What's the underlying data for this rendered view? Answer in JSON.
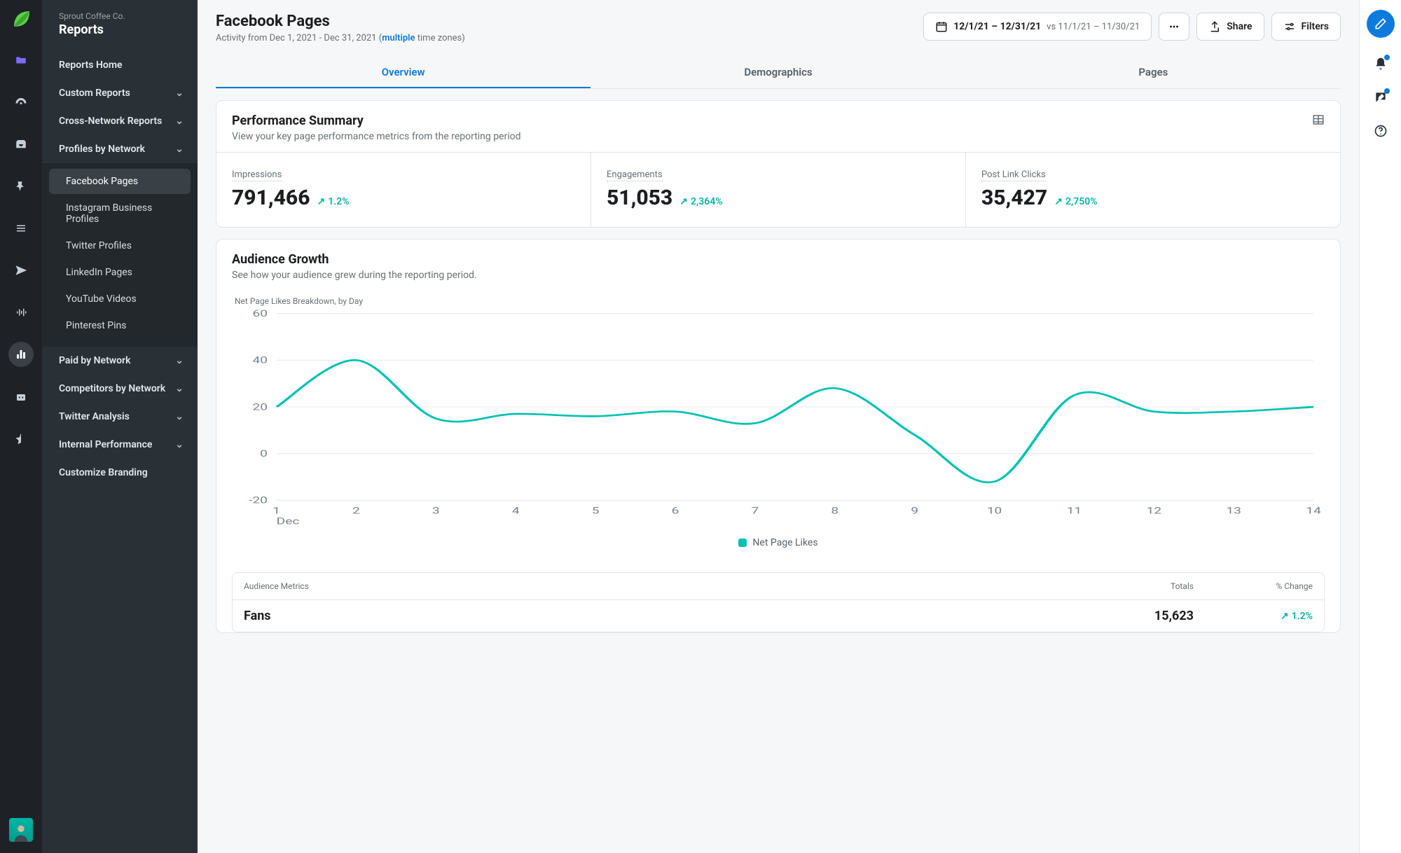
{
  "org": {
    "name": "Sprout Coffee Co.",
    "section": "Reports"
  },
  "sidebar": {
    "home": "Reports Home",
    "custom": "Custom Reports",
    "cross": "Cross-Network Reports",
    "profiles": "Profiles by Network",
    "sub": {
      "facebook": "Facebook Pages",
      "instagram": "Instagram Business Profiles",
      "twitter": "Twitter Profiles",
      "linkedin": "LinkedIn Pages",
      "youtube": "YouTube Videos",
      "pinterest": "Pinterest Pins"
    },
    "paid": "Paid by Network",
    "competitors": "Competitors by Network",
    "twitter_analysis": "Twitter Analysis",
    "internal": "Internal Performance",
    "branding": "Customize Branding"
  },
  "header": {
    "title": "Facebook Pages",
    "activity_prefix": "Activity from Dec 1, 2021 - Dec 31, 2021 (",
    "multiple": "multiple",
    "activity_suffix": " time zones)",
    "date_main": "12/1/21 – 12/31/21",
    "date_vs": " vs 11/1/21 – 11/30/21",
    "share": "Share",
    "filters": "Filters"
  },
  "tabs": {
    "overview": "Overview",
    "demographics": "Demographics",
    "pages": "Pages"
  },
  "perf": {
    "title": "Performance Summary",
    "sub": "View your key page performance metrics from the reporting period",
    "metrics": {
      "impressions": {
        "label": "Impressions",
        "value": "791,466",
        "delta": "1.2%"
      },
      "engagements": {
        "label": "Engagements",
        "value": "51,053",
        "delta": "2,364%"
      },
      "clicks": {
        "label": "Post Link Clicks",
        "value": "35,427",
        "delta": "2,750%"
      }
    }
  },
  "growth": {
    "title": "Audience Growth",
    "sub": "See how your audience grew during the reporting period.",
    "chart_caption": "Net Page Likes Breakdown, by Day",
    "legend": "Net Page Likes",
    "x_month": "Dec",
    "table": {
      "h1": "Audience Metrics",
      "h2": "Totals",
      "h3": "% Change",
      "fans_label": "Fans",
      "fans_total": "15,623",
      "fans_change": "1.2%"
    }
  },
  "chart_data": {
    "type": "line",
    "title": "Net Page Likes Breakdown, by Day",
    "xlabel": "Dec",
    "ylabel": "",
    "ylim": [
      -20,
      60
    ],
    "yticks": [
      -20,
      0,
      20,
      40,
      60
    ],
    "x": [
      1,
      2,
      3,
      4,
      5,
      6,
      7,
      8,
      9,
      10,
      11,
      12,
      13,
      14
    ],
    "series": [
      {
        "name": "Net Page Likes",
        "values": [
          20,
          40,
          15,
          17,
          16,
          18,
          13,
          28,
          8,
          -12,
          25,
          18,
          18,
          20
        ]
      }
    ]
  }
}
